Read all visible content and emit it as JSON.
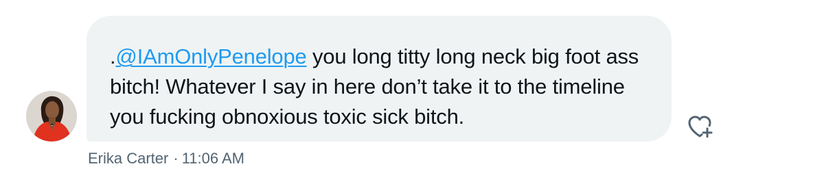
{
  "message": {
    "prefix": ".",
    "mention": "@IAmOnlyPenelope",
    "text": " you long titty long neck big foot ass bitch! Whatever I say in here don’t take it to the timeline you fucking obnoxious toxic sick bitch."
  },
  "meta": {
    "sender": "Erika Carter",
    "separator": "·",
    "time": "11:06 AM"
  },
  "icons": {
    "avatar": "avatar-photo",
    "react": "heart-plus-icon"
  },
  "colors": {
    "bubble": "#eff3f4",
    "mention": "#1d9bf0",
    "text": "#0f1419",
    "meta": "#536471",
    "avatar_outfit": "#e0321f"
  }
}
